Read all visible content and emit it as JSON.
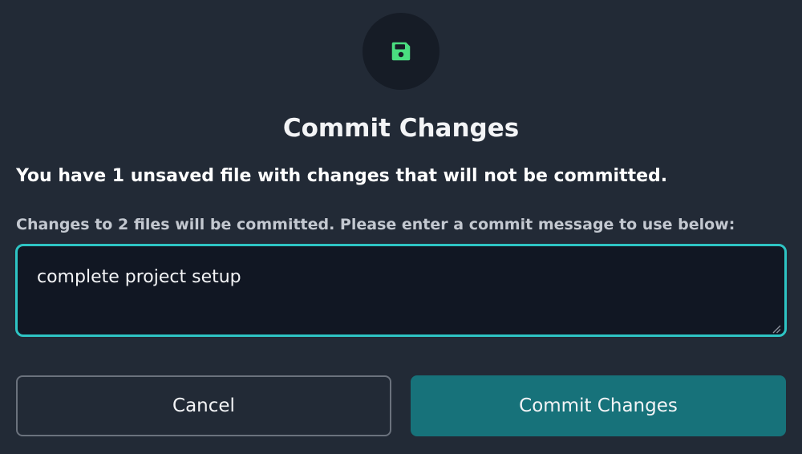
{
  "dialog": {
    "icon": "floppy-disk-icon",
    "icon_color": "#4ade80",
    "title": "Commit Changes",
    "warning": "You have 1 unsaved file with changes that will not be committed.",
    "info": "Changes to 2 files will be committed. Please enter a commit message to use below:",
    "message_value": "complete project setup",
    "cancel_label": "Cancel",
    "commit_label": "Commit Changes"
  },
  "colors": {
    "background": "#222a36",
    "accent": "#2ec4c4",
    "primary_button": "#17727a"
  }
}
